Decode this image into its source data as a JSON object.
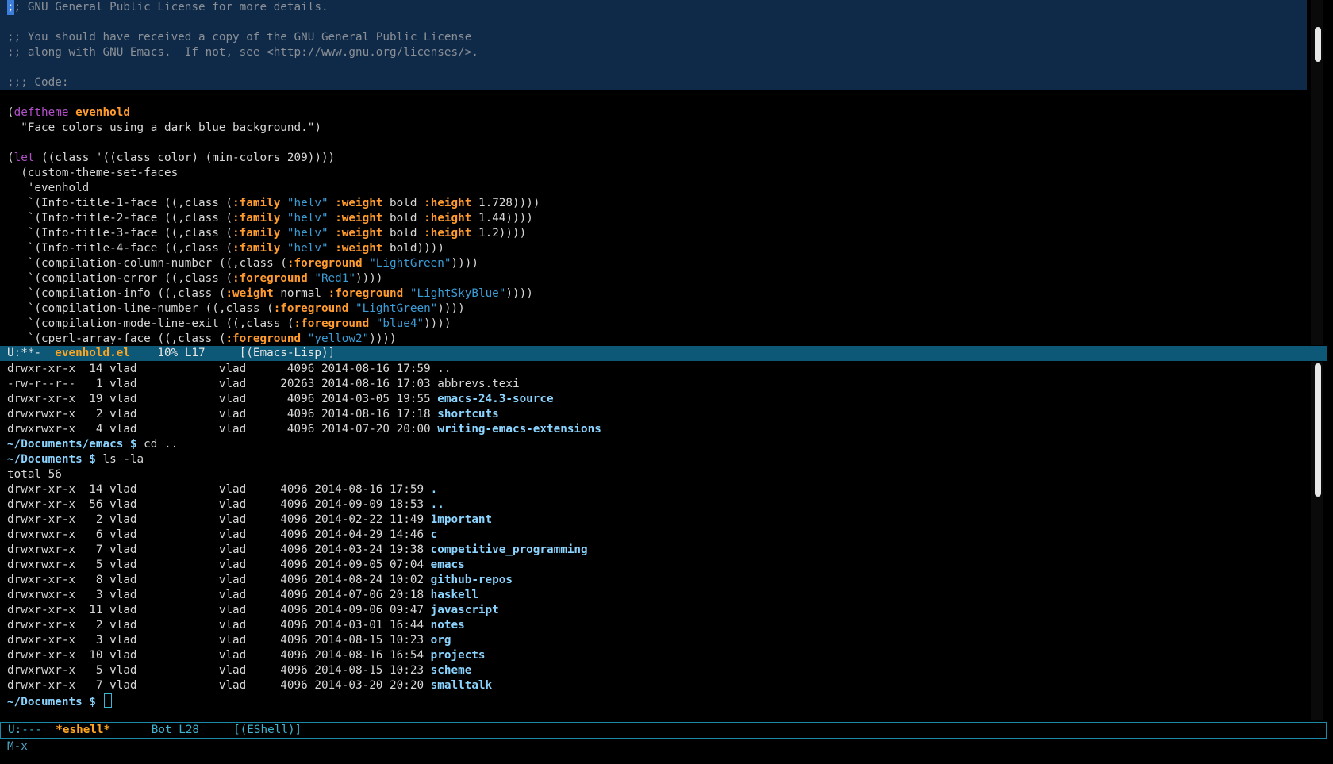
{
  "top_window": {
    "comment_lines": [
      ";; GNU General Public License for more details.",
      "",
      ";; You should have received a copy of the GNU General Public License",
      ";; along with GNU Emacs.  If not, see <http://www.gnu.org/licenses/>.",
      "",
      ";;; Code:"
    ],
    "code": {
      "deftheme_kw": "deftheme",
      "theme_name": "evenhold",
      "docstring": "  \"Face colors using a dark blue background.\")",
      "let_kw": "let",
      "let_rest": " ((class '((class color) (min-colors 209))))",
      "custom_line": "  (custom-theme-set-faces",
      "evenhold_line": "   'evenhold",
      "faces": [
        {
          "pre": "   `(Info-title-1-face ((,class (",
          "k1": ":family",
          "s1": " \"helv\" ",
          "k2": ":weight",
          "m": " bold ",
          "k3": ":height",
          "post": " 1.728))))"
        },
        {
          "pre": "   `(Info-title-2-face ((,class (",
          "k1": ":family",
          "s1": " \"helv\" ",
          "k2": ":weight",
          "m": " bold ",
          "k3": ":height",
          "post": " 1.44))))"
        },
        {
          "pre": "   `(Info-title-3-face ((,class (",
          "k1": ":family",
          "s1": " \"helv\" ",
          "k2": ":weight",
          "m": " bold ",
          "k3": ":height",
          "post": " 1.2))))"
        },
        {
          "pre": "   `(Info-title-4-face ((,class (",
          "k1": ":family",
          "s1": " \"helv\" ",
          "k2": ":weight",
          "m": "",
          "k3": "",
          "post": " bold))))"
        }
      ],
      "fg_faces": [
        {
          "pre": "   `(compilation-column-number ((,class (",
          "key": ":foreground",
          "str": " \"LightGreen\"",
          "post": "))))"
        },
        {
          "pre": "   `(compilation-error ((,class (",
          "key": ":foreground",
          "str": " \"Red1\"",
          "post": "))))"
        }
      ],
      "info_line": {
        "pre": "   `(compilation-info ((,class (",
        "k1": ":weight",
        "m": " normal ",
        "k2": ":foreground",
        "str": " \"LightSkyBlue\"",
        "post": "))))"
      },
      "fg_faces2": [
        {
          "pre": "   `(compilation-line-number ((,class (",
          "key": ":foreground",
          "str": " \"LightGreen\"",
          "post": "))))"
        },
        {
          "pre": "   `(compilation-mode-line-exit ((,class (",
          "key": ":foreground",
          "str": " \"blue4\"",
          "post": "))))"
        },
        {
          "pre": "   `(cperl-array-face ((,class (",
          "key": ":foreground",
          "str": " \"yellow2\"",
          "post": "))))"
        }
      ]
    }
  },
  "modeline_top": {
    "status": "U:**-  ",
    "buffer": "evenhold.el",
    "position": "    10% L17     ",
    "mode": "[(Emacs-Lisp)]"
  },
  "shell": {
    "listing1": [
      {
        "perm": "drwxr-xr-x",
        "links": "14",
        "owner": "vlad",
        "group": "vlad",
        "size": " 4096",
        "date": "2014-08-16 17:59",
        "name": "..",
        "dir": false
      },
      {
        "perm": "-rw-r--r--",
        "links": " 1",
        "owner": "vlad",
        "group": "vlad",
        "size": "20263",
        "date": "2014-08-16 17:03",
        "name": "abbrevs.texi",
        "dir": false
      },
      {
        "perm": "drwxr-xr-x",
        "links": "19",
        "owner": "vlad",
        "group": "vlad",
        "size": " 4096",
        "date": "2014-03-05 19:55",
        "name": "emacs-24.3-source",
        "dir": true
      },
      {
        "perm": "drwxrwxr-x",
        "links": " 2",
        "owner": "vlad",
        "group": "vlad",
        "size": " 4096",
        "date": "2014-08-16 17:18",
        "name": "shortcuts",
        "dir": true
      },
      {
        "perm": "drwxrwxr-x",
        "links": " 4",
        "owner": "vlad",
        "group": "vlad",
        "size": " 4096",
        "date": "2014-07-20 20:00",
        "name": "writing-emacs-extensions",
        "dir": true
      }
    ],
    "cmd1_prompt": "~/Documents/emacs $",
    "cmd1": " cd ..",
    "cmd2_prompt": "~/Documents $",
    "cmd2": " ls -la",
    "total": "total 56",
    "listing2": [
      {
        "perm": "drwxr-xr-x",
        "links": "14",
        "owner": "vlad",
        "group": "vlad",
        "size": "4096",
        "date": "2014-08-16 17:59",
        "name": ".",
        "dir": true
      },
      {
        "perm": "drwxr-xr-x",
        "links": "56",
        "owner": "vlad",
        "group": "vlad",
        "size": "4096",
        "date": "2014-09-09 18:53",
        "name": "..",
        "dir": true
      },
      {
        "perm": "drwxr-xr-x",
        "links": " 2",
        "owner": "vlad",
        "group": "vlad",
        "size": "4096",
        "date": "2014-02-22 11:49",
        "name": "1mportant",
        "dir": true
      },
      {
        "perm": "drwxrwxr-x",
        "links": " 6",
        "owner": "vlad",
        "group": "vlad",
        "size": "4096",
        "date": "2014-04-29 14:46",
        "name": "c",
        "dir": true
      },
      {
        "perm": "drwxrwxr-x",
        "links": " 7",
        "owner": "vlad",
        "group": "vlad",
        "size": "4096",
        "date": "2014-03-24 19:38",
        "name": "competitive_programming",
        "dir": true
      },
      {
        "perm": "drwxrwxr-x",
        "links": " 5",
        "owner": "vlad",
        "group": "vlad",
        "size": "4096",
        "date": "2014-09-05 07:04",
        "name": "emacs",
        "dir": true
      },
      {
        "perm": "drwxr-xr-x",
        "links": " 8",
        "owner": "vlad",
        "group": "vlad",
        "size": "4096",
        "date": "2014-08-24 10:02",
        "name": "github-repos",
        "dir": true
      },
      {
        "perm": "drwxrwxr-x",
        "links": " 3",
        "owner": "vlad",
        "group": "vlad",
        "size": "4096",
        "date": "2014-07-06 20:18",
        "name": "haskell",
        "dir": true
      },
      {
        "perm": "drwxr-xr-x",
        "links": "11",
        "owner": "vlad",
        "group": "vlad",
        "size": "4096",
        "date": "2014-09-06 09:47",
        "name": "javascript",
        "dir": true
      },
      {
        "perm": "drwxr-xr-x",
        "links": " 2",
        "owner": "vlad",
        "group": "vlad",
        "size": "4096",
        "date": "2014-03-01 16:44",
        "name": "notes",
        "dir": true
      },
      {
        "perm": "drwxr-xr-x",
        "links": " 3",
        "owner": "vlad",
        "group": "vlad",
        "size": "4096",
        "date": "2014-08-15 10:23",
        "name": "org",
        "dir": true
      },
      {
        "perm": "drwxr-xr-x",
        "links": "10",
        "owner": "vlad",
        "group": "vlad",
        "size": "4096",
        "date": "2014-08-16 16:54",
        "name": "projects",
        "dir": true
      },
      {
        "perm": "drwxrwxr-x",
        "links": " 5",
        "owner": "vlad",
        "group": "vlad",
        "size": "4096",
        "date": "2014-08-15 10:23",
        "name": "scheme",
        "dir": true
      },
      {
        "perm": "drwxr-xr-x",
        "links": " 7",
        "owner": "vlad",
        "group": "vlad",
        "size": "4096",
        "date": "2014-03-20 20:20",
        "name": "smalltalk",
        "dir": true
      }
    ],
    "final_prompt": "~/Documents $"
  },
  "modeline_bottom": {
    "status": "U:---  ",
    "buffer": "*eshell*",
    "position": "      Bot L28     ",
    "mode": "[(EShell)]"
  },
  "echo_area": "M-x",
  "colors": {
    "region": "#0f2a48",
    "modeline_active": "#0d5876",
    "keyword": "#b04fc6",
    "function": "#ff9b2f",
    "string": "#3b9dd6",
    "directory": "#8ad4ff"
  }
}
